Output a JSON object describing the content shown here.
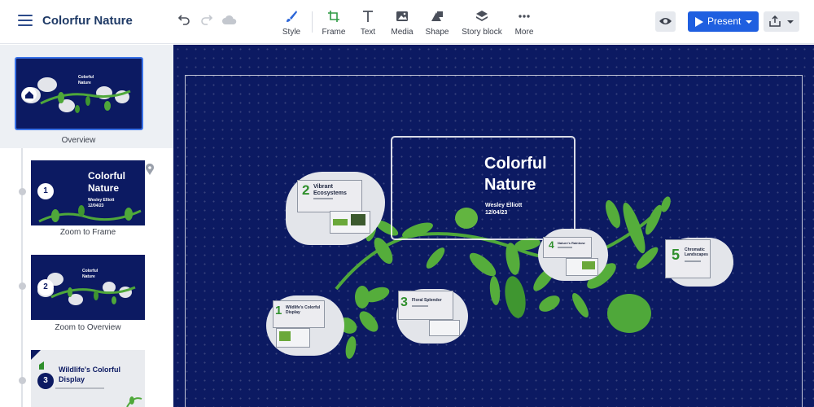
{
  "header": {
    "title": "Colorfur Nature"
  },
  "toolbar": {
    "tools": [
      {
        "id": "style",
        "label": "Style",
        "icon": "brush-icon"
      },
      {
        "id": "frame",
        "label": "Frame",
        "icon": "frame-icon"
      },
      {
        "id": "text",
        "label": "Text",
        "icon": "text-icon"
      },
      {
        "id": "media",
        "label": "Media",
        "icon": "image-icon"
      },
      {
        "id": "shape",
        "label": "Shape",
        "icon": "shape-icon"
      },
      {
        "id": "story_block",
        "label": "Story block",
        "icon": "layers-icon"
      },
      {
        "id": "more",
        "label": "More",
        "icon": "more-dots-icon"
      }
    ],
    "present_label": "Present",
    "accent_color": "#1f5fe0"
  },
  "sidebar": {
    "overview_label": "Overview",
    "overview_thumb": {
      "title_line1": "Colorful",
      "title_line2": "Nature"
    },
    "steps": [
      {
        "number": "1",
        "label": "Zoom to Frame",
        "title_line1": "Colorful",
        "title_line2": "Nature",
        "author": "Wesley Elliott",
        "date": "12/04/23"
      },
      {
        "number": "2",
        "label": "Zoom to Overview",
        "title_line1": "Colorful",
        "title_line2": "Nature"
      },
      {
        "number": "3",
        "title_line1": "Wildlife's Colorful",
        "title_line2": "Display"
      }
    ]
  },
  "canvas": {
    "background_color": "#0c1a62",
    "title_line1": "Colorful",
    "title_line2": "Nature",
    "author": "Wesley Elliott",
    "date": "12/04/23",
    "topics": [
      {
        "number": "1",
        "title_line1": "Wildlife's Colorful",
        "title_line2": "Display"
      },
      {
        "number": "2",
        "title_line1": "Vibrant",
        "title_line2": "Ecosystems"
      },
      {
        "number": "3",
        "title_line1": "Floral Splendor",
        "title_line2": ""
      },
      {
        "number": "4",
        "title_line1": "Nature's Rainbow",
        "title_line2": ""
      },
      {
        "number": "5",
        "title_line1": "Chromatic",
        "title_line2": "Landscapes"
      }
    ]
  }
}
